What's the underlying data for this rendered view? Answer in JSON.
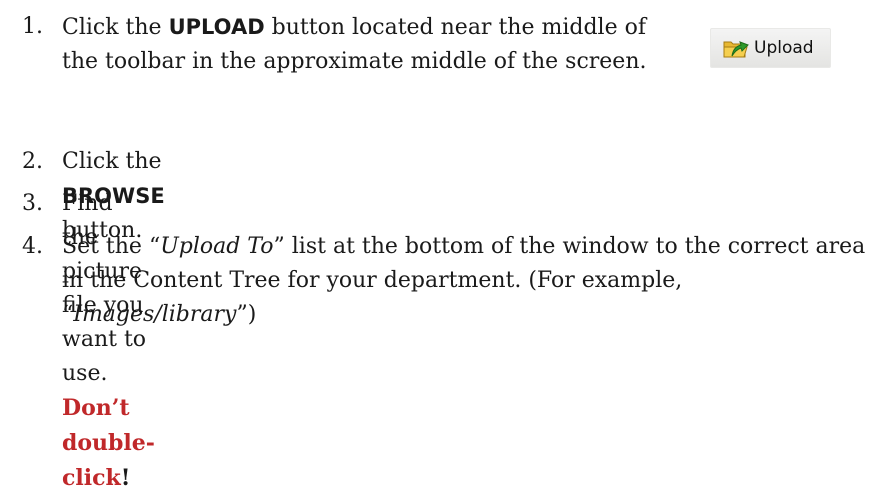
{
  "steps": [
    {
      "number": "1.",
      "before": "Click the ",
      "keyword": "UPLOAD",
      "after": " button located near the middle of the toolbar in the approximate middle of the screen."
    },
    {
      "number": "2.",
      "before": "Click the ",
      "keyword": "BROWSE",
      "after": " button."
    },
    {
      "number": "3.",
      "text": "Find the picture file you want to use. ",
      "warning": "Don’t double-click",
      "warning_end": "!"
    },
    {
      "number": "4.",
      "t1": "Set the “",
      "i1": "Upload To",
      "t2": "” list at the bottom of the window to the correct area in the Content Tree for your department. (For example, “",
      "i2": "Images/library",
      "t3": "”)"
    }
  ],
  "upload_button": {
    "label": "Upload",
    "icon": "folder-upload-arrow-icon"
  },
  "colors": {
    "text": "#1a1a1a",
    "warning": "#c0282a",
    "button_bg": "#ececea",
    "folder": "#e8b832",
    "arrow": "#2e9a2a"
  }
}
